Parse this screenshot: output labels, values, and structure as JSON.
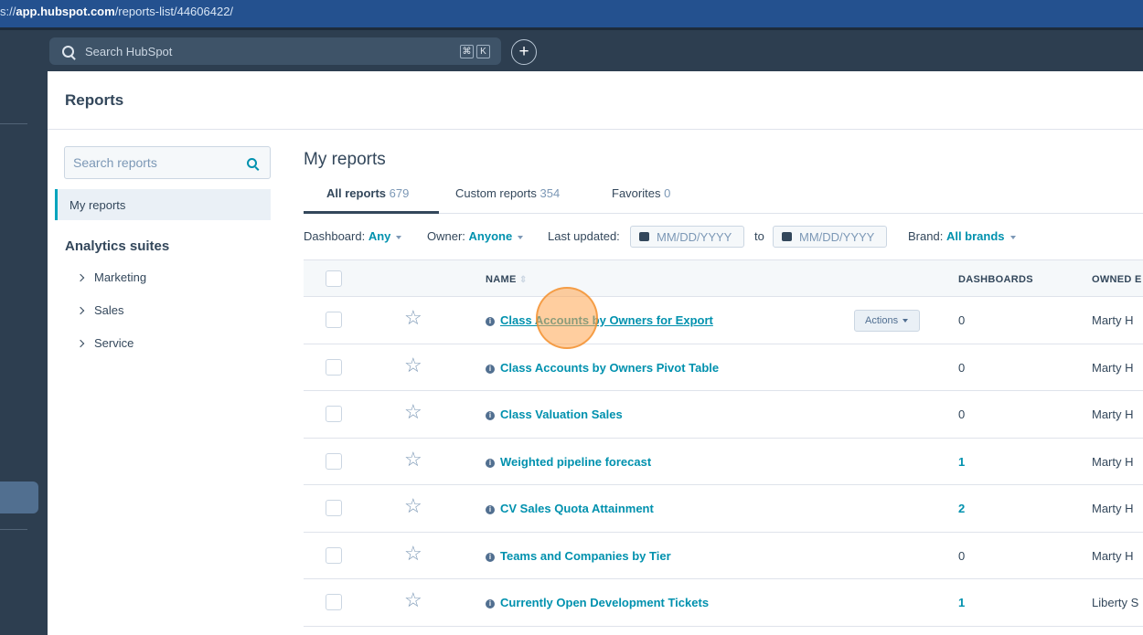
{
  "browser": {
    "url_prefix": "s://",
    "url_host": "app.hubspot.com",
    "url_path": "/reports-list/44606422/"
  },
  "topbar": {
    "search_placeholder": "Search HubSpot",
    "shortcut_keys": [
      "⌘",
      "K"
    ],
    "plus_label": "+"
  },
  "page": {
    "title": "Reports"
  },
  "sidebar": {
    "search_placeholder": "Search reports",
    "my_reports_label": "My reports",
    "suites_heading": "Analytics suites",
    "suites": [
      "Marketing",
      "Sales",
      "Service"
    ]
  },
  "main": {
    "title": "My reports",
    "tabs": [
      {
        "label": "All reports",
        "count": "679"
      },
      {
        "label": "Custom reports",
        "count": "354"
      },
      {
        "label": "Favorites",
        "count": "0"
      }
    ],
    "filters": {
      "dashboard_label": "Dashboard:",
      "dashboard_value": "Any",
      "owner_label": "Owner:",
      "owner_value": "Anyone",
      "updated_label": "Last updated:",
      "date_placeholder": "MM/DD/YYYY",
      "to_label": "to",
      "brand_label": "Brand:",
      "brand_value": "All brands"
    },
    "table": {
      "columns": {
        "name": "NAME",
        "dashboards": "DASHBOARDS",
        "owner": "OWNED E"
      },
      "actions_label": "Actions",
      "rows": [
        {
          "name": "Class Accounts by Owners for Export",
          "dashboards": "0",
          "owner": "Marty H"
        },
        {
          "name": "Class Accounts by Owners Pivot Table",
          "dashboards": "0",
          "owner": "Marty H"
        },
        {
          "name": "Class Valuation Sales",
          "dashboards": "0",
          "owner": "Marty H"
        },
        {
          "name": "Weighted pipeline forecast",
          "dashboards": "1",
          "owner": "Marty H"
        },
        {
          "name": "CV Sales Quota Attainment",
          "dashboards": "2",
          "owner": "Marty H"
        },
        {
          "name": "Teams and Companies by Tier",
          "dashboards": "0",
          "owner": "Marty H"
        },
        {
          "name": "Currently Open Development Tickets",
          "dashboards": "1",
          "owner": "Liberty S"
        }
      ]
    }
  }
}
